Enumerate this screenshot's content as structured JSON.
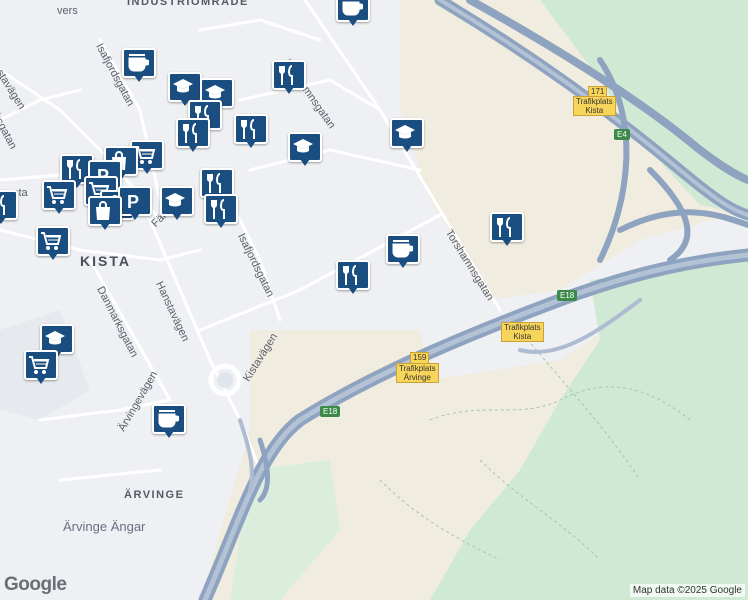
{
  "map": {
    "labels": {
      "district_kista": "KISTA",
      "district_arvinge": "ÄRVINGE",
      "industri": "INDUSTRIOMRÅDE",
      "arvinge_angar": "Ärvinge Ängar",
      "kista_partial": "sta",
      "vers_partial": "vers"
    },
    "streets": {
      "torshamnsgatan_n": "Torshamnsgatan",
      "torshamnsgatan_s": "Torshamnsgatan",
      "isafjordsgatan_n": "Isafjordsgatan",
      "isafjordsgatan_s": "Isafjordsgatan",
      "kistavagen": "Kistavägen",
      "hanstavagen": "Hanstavägen",
      "danmarksgatan": "Danmarksgatan",
      "arvingevagen": "Ärvingevägen",
      "staviagen": "stavägen",
      "faro": "Färö",
      "kista_short": "ksgatan"
    },
    "roads": {
      "e18_a": "E18",
      "e18_b": "E18",
      "e4": "E4",
      "r171": "171",
      "r159": "159",
      "trafikplats_kista_n_1": "Trafikplats",
      "trafikplats_kista_n_2": "Kista",
      "trafikplats_kista_s_1": "Trafikplats",
      "trafikplats_kista_s_2": "Kista",
      "trafikplats_arvinge_1": "Trafikplats",
      "trafikplats_arvinge_2": "Ärvinge"
    },
    "colors": {
      "background": "#eef0f3",
      "green": "#cfe9d5",
      "sand": "#f1ece0",
      "highway": "#8ea3bf",
      "poi": "#1b4e80"
    },
    "poi_icons": [
      "cafe-icon",
      "restaurant-icon",
      "school-icon",
      "shopping-cart-icon",
      "shopping-bag-icon",
      "parking-icon"
    ]
  },
  "footer": {
    "logo": "Google",
    "attribution": "Map data ©2025 Google"
  }
}
